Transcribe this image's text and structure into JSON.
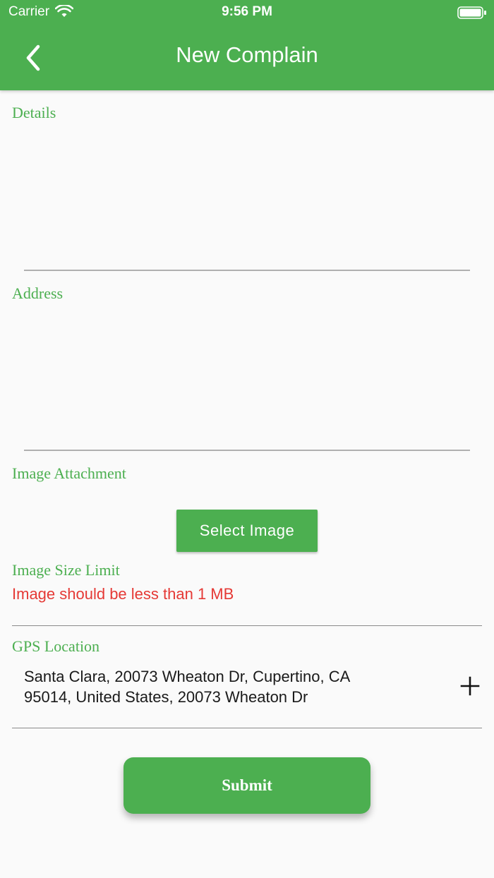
{
  "status_bar": {
    "carrier": "Carrier",
    "time": "9:56 PM"
  },
  "app_bar": {
    "title": "New Complain",
    "back_icon": "chevron-left-icon"
  },
  "form": {
    "details_label": "Details",
    "address_label": "Address",
    "image_attachment_label": "Image Attachment",
    "select_image_button": "Select Image",
    "image_size_limit_label": "Image Size Limit",
    "image_size_error": "Image should be less than 1 MB",
    "gps_location_label": "GPS Location",
    "gps_address_line1": "Santa Clara, 20073 Wheaton Dr, Cupertino, CA",
    "gps_address_line2": "95014, United States, 20073 Wheaton Dr",
    "add_location_icon": "plus-icon",
    "submit_button": "Submit"
  },
  "colors": {
    "accent": "#4caf50",
    "error": "#e53935",
    "background": "#fafafa"
  }
}
